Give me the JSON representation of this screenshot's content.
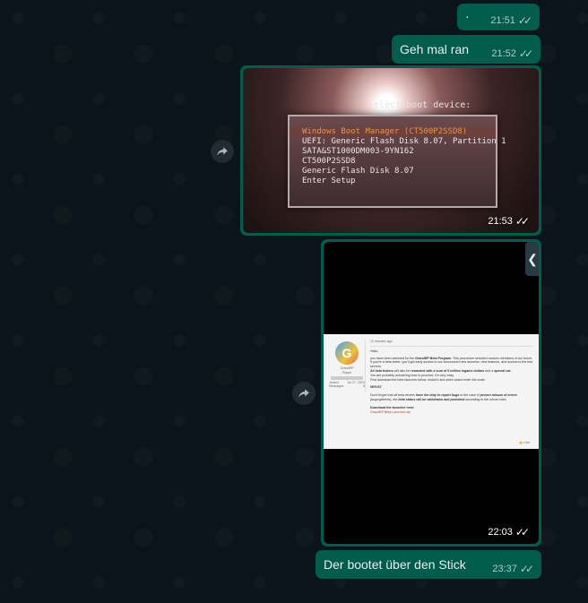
{
  "chat": {
    "messages": [
      {
        "kind": "text",
        "text": "·",
        "time": "21:51",
        "ticks": "✓✓"
      },
      {
        "kind": "text",
        "text": "Geh mal ran",
        "time": "21:52",
        "ticks": "✓✓"
      },
      {
        "kind": "image",
        "time": "21:53",
        "ticks": "✓✓",
        "boot_menu": {
          "title": "elect boot device:",
          "items": [
            "Windows Boot Manager (CT500P2SSD8)",
            "UEFI: Generic Flash Disk 8.07, Partition 1",
            "SATA&ST1000DM003-9YN162",
            "CT500P2SSD8",
            "Generic Flash Disk 8.07",
            "Enter Setup"
          ]
        }
      },
      {
        "kind": "video",
        "time": "22:03",
        "ticks": "✓✓",
        "post": {
          "timestamp": "12 minutes ago",
          "user": "GrandRP",
          "role": "Player",
          "joined_label": "Joined",
          "joined_value": "Jul 27, 2023",
          "messages_label": "Messages",
          "messages_value": "8",
          "greeting": "Hello,",
          "p1a": "you have been selected for the ",
          "p1b": "GrandRP Beta Program",
          "p1c": ". This procedure selected random members of our forum. If you're a beta tester, you'll get early access to our announced new launcher, new features, and access to the test servers.",
          "p2a": "All beta testers",
          "p2b": " will also be ",
          "p2c": "rewarded with a sum of 5 million ingame dollars",
          "p2d": " and a ",
          "p2e": "special car",
          "p2f": ".",
          "p3": "You are probably wondering how to proceed. It's very easy.",
          "p4": "First download the beta launcher below, install it and when asked enter the code:",
          "code": "0E9V67",
          "p5a": "Don't forget that all beta testers ",
          "p5b": "have the duty to report bugs",
          "p5c": " in the case of ",
          "p5d": "proven misuse of errors",
          "p5e": " (bugs/glitches), the ",
          "p5f": "beta status will be withdrawn and punished",
          "p5g": " according to the server rules",
          "dl": "Download the launcher here:",
          "link": "GrandRP Beta Launcher.zip",
          "likes": "👍 Like"
        }
      },
      {
        "kind": "text",
        "text": "Der bootet über den Stick",
        "time": "23:37",
        "ticks": "✓✓"
      }
    ]
  },
  "colors": {
    "background": "#0b141a",
    "outgoing_bubble": "#005c4b",
    "text": "#e9edef"
  },
  "icons": {
    "forward": "forward-arrow-icon",
    "read": "double-check-icon",
    "side_tab": "chevron-left-icon"
  }
}
